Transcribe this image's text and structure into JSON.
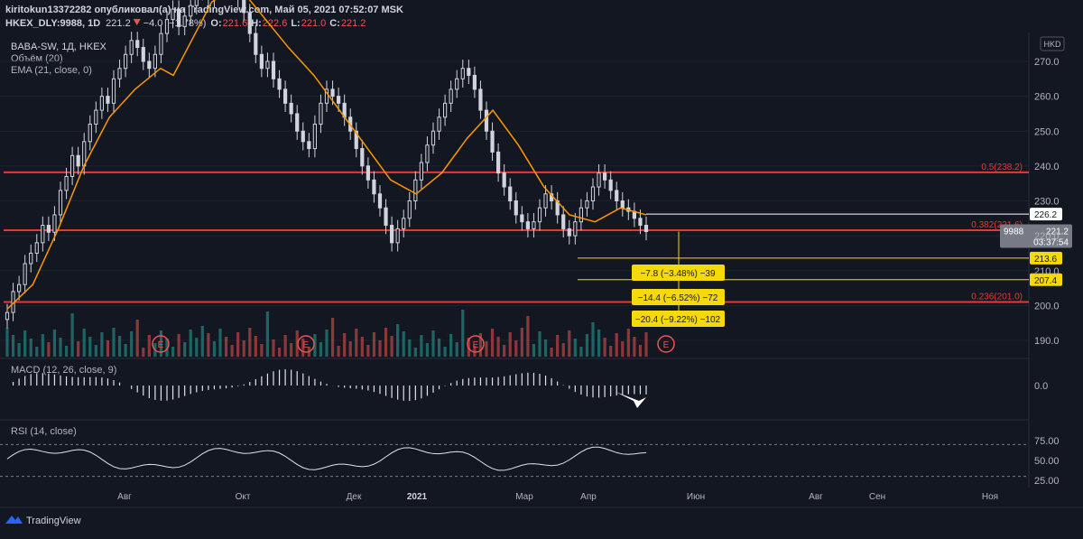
{
  "header": {
    "line1": "kiritokun13372282 опубликовал(а) на TradingView.com, Май 05, 2021 07:52:07 MSK",
    "symbol": "HKEX_DLY:9988, 1D",
    "last": "221.2",
    "change": "−4.0 (−1.78%)",
    "ohlc": [
      {
        "k": "O:",
        "v": "221.6"
      },
      {
        "k": "H:",
        "v": "222.6"
      },
      {
        "k": "L:",
        "v": "221.0"
      },
      {
        "k": "C:",
        "v": "221.2"
      }
    ]
  },
  "legend": {
    "title": "BABA-SW, 1Д, HKEX",
    "volume": "Объём (20)",
    "ema": "EMA (21, close, 0)"
  },
  "currency": "HKD",
  "footer": {
    "brand": "TradingView"
  },
  "colors": {
    "bg": "#131722",
    "candle": "#d1d4dc",
    "ema": "#ff9800",
    "fib": "#e53935",
    "yellow": "#f5d90a",
    "vol_up": "#26a69a",
    "vol_down": "#ef5350"
  },
  "chart_data": [
    {
      "type": "candlestick",
      "title": "BABA-SW, 1Д, HKEX",
      "ylim": [
        185,
        280
      ],
      "y_ticks": [
        190.0,
        200.0,
        210.0,
        220.0,
        230.0,
        240.0,
        250.0,
        260.0,
        270.0
      ],
      "y_tick_labels": [
        "190.0",
        "200.0",
        "210.0",
        "220.0",
        "230.0",
        "240.0",
        "250.0",
        "260.0",
        "270.0"
      ],
      "x_labels": [
        "Авг",
        "Окт",
        "Дек",
        "2021",
        "Мар",
        "Апр",
        "Июн",
        "Авг",
        "Сен",
        "Ноя"
      ],
      "close_series": [
        198,
        204,
        206,
        212,
        215,
        218,
        223,
        221,
        226,
        233,
        237,
        243,
        240,
        247,
        252,
        256,
        260,
        258,
        265,
        268,
        272,
        276,
        274,
        270,
        268,
        272,
        278,
        282,
        285,
        280,
        283,
        286,
        290,
        292,
        288,
        295,
        300,
        296,
        292,
        288,
        284,
        278,
        272,
        268,
        270,
        265,
        262,
        258,
        255,
        250,
        247,
        245,
        252,
        258,
        262,
        260,
        258,
        254,
        250,
        245,
        240,
        236,
        232,
        228,
        223,
        218,
        222,
        225,
        230,
        236,
        241,
        246,
        250,
        254,
        258,
        262,
        265,
        268,
        266,
        262,
        256,
        250,
        244,
        238,
        234,
        230,
        226,
        224,
        222,
        224,
        228,
        232,
        230,
        226,
        222,
        220,
        224,
        228,
        230,
        234,
        238,
        236,
        233,
        230,
        228,
        227,
        225,
        223,
        221.2
      ],
      "ema": [
        {
          "d": 0,
          "v": 199
        },
        {
          "d": 10,
          "v": 206
        },
        {
          "d": 20,
          "v": 222
        },
        {
          "d": 30,
          "v": 240
        },
        {
          "d": 40,
          "v": 254
        },
        {
          "d": 50,
          "v": 262
        },
        {
          "d": 60,
          "v": 268
        },
        {
          "d": 65,
          "v": 266
        },
        {
          "d": 70,
          "v": 273
        },
        {
          "d": 80,
          "v": 287
        },
        {
          "d": 90,
          "v": 292
        },
        {
          "d": 100,
          "v": 283
        },
        {
          "d": 110,
          "v": 274
        },
        {
          "d": 120,
          "v": 266
        },
        {
          "d": 130,
          "v": 256
        },
        {
          "d": 140,
          "v": 246
        },
        {
          "d": 150,
          "v": 236
        },
        {
          "d": 160,
          "v": 232
        },
        {
          "d": 170,
          "v": 238
        },
        {
          "d": 180,
          "v": 248
        },
        {
          "d": 190,
          "v": 256
        },
        {
          "d": 200,
          "v": 246
        },
        {
          "d": 210,
          "v": 234
        },
        {
          "d": 220,
          "v": 226
        },
        {
          "d": 230,
          "v": 224
        },
        {
          "d": 240,
          "v": 228
        },
        {
          "d": 250,
          "v": 226
        }
      ],
      "fib_levels": [
        {
          "label": "0.5(238.2)",
          "value": 238.2
        },
        {
          "label": "0.382(221.6)",
          "value": 221.6
        },
        {
          "label": "0.236(201.0)",
          "value": 201.0
        }
      ],
      "price_marks": [
        {
          "value": 226.2,
          "label": "226.2",
          "style": "white"
        },
        {
          "value": 213.6,
          "label": "213.6",
          "style": "yellow"
        },
        {
          "value": 207.4,
          "label": "207.4",
          "style": "yellow"
        }
      ],
      "current_price": {
        "ticker": "9988",
        "price": "221.2",
        "countdown": "03:37:54"
      },
      "measures": [
        {
          "text": "−7.8 (−3.48%) −39"
        },
        {
          "text": "−14.4 (−6.52%) −72"
        },
        {
          "text": "−20.4 (−9.22%) −102"
        }
      ],
      "earnings_markers": [
        "E",
        "E",
        "E",
        "E"
      ]
    },
    {
      "type": "histogram",
      "title": "MACD (12, 26, close, 9)",
      "y_ticks": [
        0.0
      ],
      "y_tick_labels": [
        "0.0"
      ]
    },
    {
      "type": "line",
      "title": "RSI (14, close)",
      "ylim": [
        20,
        85
      ],
      "y_ticks": [
        75.0,
        50.0,
        25.0
      ],
      "y_tick_labels": [
        "75.00",
        "50.00",
        "25.00"
      ],
      "levels": [
        70,
        30
      ]
    }
  ]
}
